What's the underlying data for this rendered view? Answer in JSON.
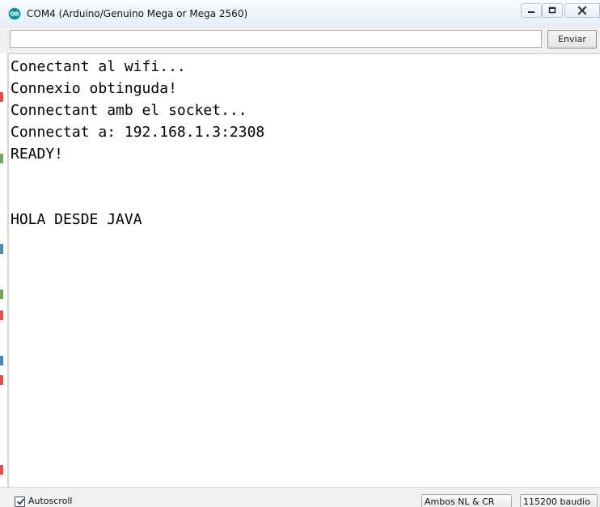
{
  "window": {
    "title": "COM4 (Arduino/Genuino Mega or Mega 2560)",
    "app_icon": "arduino-icon",
    "buttons": {
      "minimize_icon": "minimize-icon",
      "maximize_icon": "maximize-icon",
      "close_icon": "close-icon"
    }
  },
  "toolbar": {
    "input_value": "",
    "input_placeholder": "",
    "send_label": "Enviar"
  },
  "output": {
    "text": "Conectant al wifi...\nConnexio obtinguda!\nConnectant amb el socket...\nConnectat a: 192.168.1.3:2308\nREADY!\n\n\nHOLA DESDE JAVA"
  },
  "statusbar": {
    "autoscroll_label": "Autoscroll",
    "autoscroll_checked": true,
    "line_ending": "Ambos NL & CR",
    "baud_rate": "115200 baudio"
  },
  "colors": {
    "titlebar": "#edf4fa",
    "chrome": "#f0f0f0",
    "output_background": "#ffffff",
    "text": "#000000",
    "arduino_accent": "#00979c"
  }
}
